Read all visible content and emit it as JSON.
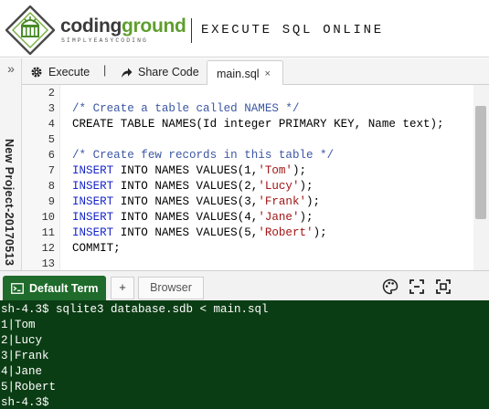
{
  "header": {
    "brand_part1": "coding",
    "brand_part2": "ground",
    "tagline": "SIMPLYEASYCODING",
    "page_title": "EXECUTE SQL ONLINE",
    "logo_icon": "codingground-logo-icon"
  },
  "side": {
    "toggle": "»",
    "project_name": "New Project-20170513"
  },
  "toolbar": {
    "execute_label": "Execute",
    "separator": "|",
    "share_label": "Share Code",
    "file_tab_label": "main.sql",
    "file_tab_close": "×"
  },
  "editor": {
    "line_numbers": [
      "2",
      "3",
      "4",
      "5",
      "6",
      "7",
      "8",
      "9",
      "10",
      "11",
      "12",
      "13"
    ],
    "lines": {
      "l3": "/* Create a table called NAMES */",
      "l4": "CREATE TABLE NAMES(Id integer PRIMARY KEY, Name text);",
      "l6": "/* Create few records in this table */",
      "insert_kw": "INSERT",
      "l7_rest": " INTO NAMES VALUES(1,",
      "l7_str": "'Tom'",
      "l8_rest": " INTO NAMES VALUES(2,",
      "l8_str": "'Lucy'",
      "l9_rest": " INTO NAMES VALUES(3,",
      "l9_str": "'Frank'",
      "l10_rest": " INTO NAMES VALUES(4,",
      "l10_str": "'Jane'",
      "l11_rest": " INTO NAMES VALUES(5,",
      "l11_str": "'Robert'",
      "close_paren": ");",
      "l12": "COMMIT;"
    }
  },
  "term_tabs": {
    "default_term": "Default Term",
    "add": "+",
    "browser": "Browser"
  },
  "terminal": {
    "lines": [
      "sh-4.3$ sqlite3 database.sdb < main.sql",
      "1|Tom",
      "2|Lucy",
      "3|Frank",
      "4|Jane",
      "5|Robert",
      "sh-4.3$"
    ]
  },
  "colors": {
    "brand_green": "#5f9e2e",
    "terminal_bg": "#0b3d14",
    "term_tab_bg": "#1f6b2b",
    "keyword": "#1726c9",
    "string": "#a31515",
    "comment": "#3c57a3"
  }
}
